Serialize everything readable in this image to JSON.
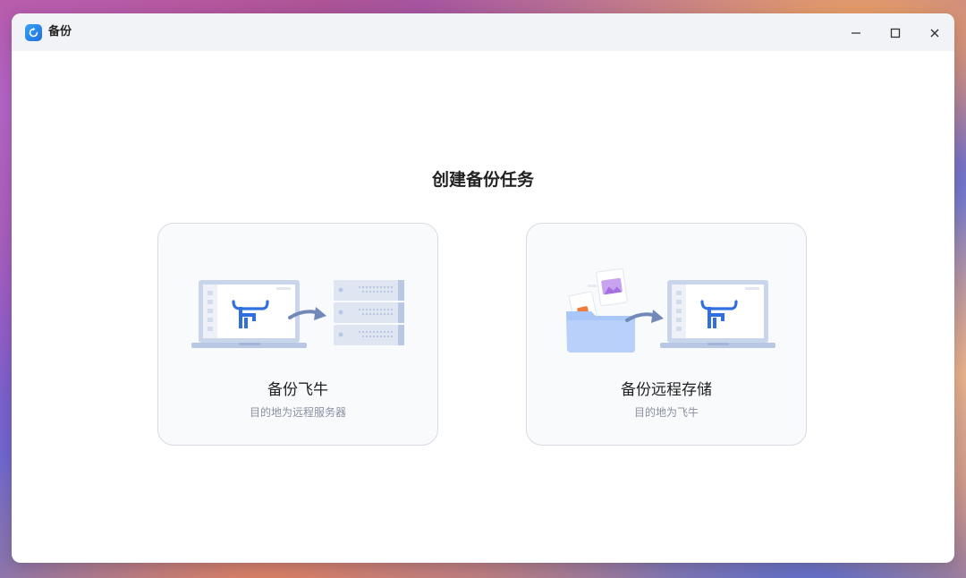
{
  "window": {
    "title": "备份",
    "icon": "backup-app-icon",
    "controls": {
      "minimize": "minimize-icon",
      "maximize": "maximize-icon",
      "close": "close-icon"
    }
  },
  "main": {
    "heading": "创建备份任务",
    "cards": [
      {
        "title": "备份飞牛",
        "description": "目的地为远程服务器",
        "illustration": "laptop-to-server-illustration"
      },
      {
        "title": "备份远程存储",
        "description": "目的地为飞牛",
        "illustration": "folder-to-laptop-illustration"
      }
    ]
  },
  "colors": {
    "accent": "#2f6fe0",
    "card_border": "#d8dbe3",
    "card_bg": "#f9fafc",
    "illustration_blue": "#b7c7e4",
    "arrow": "#7288b8"
  }
}
